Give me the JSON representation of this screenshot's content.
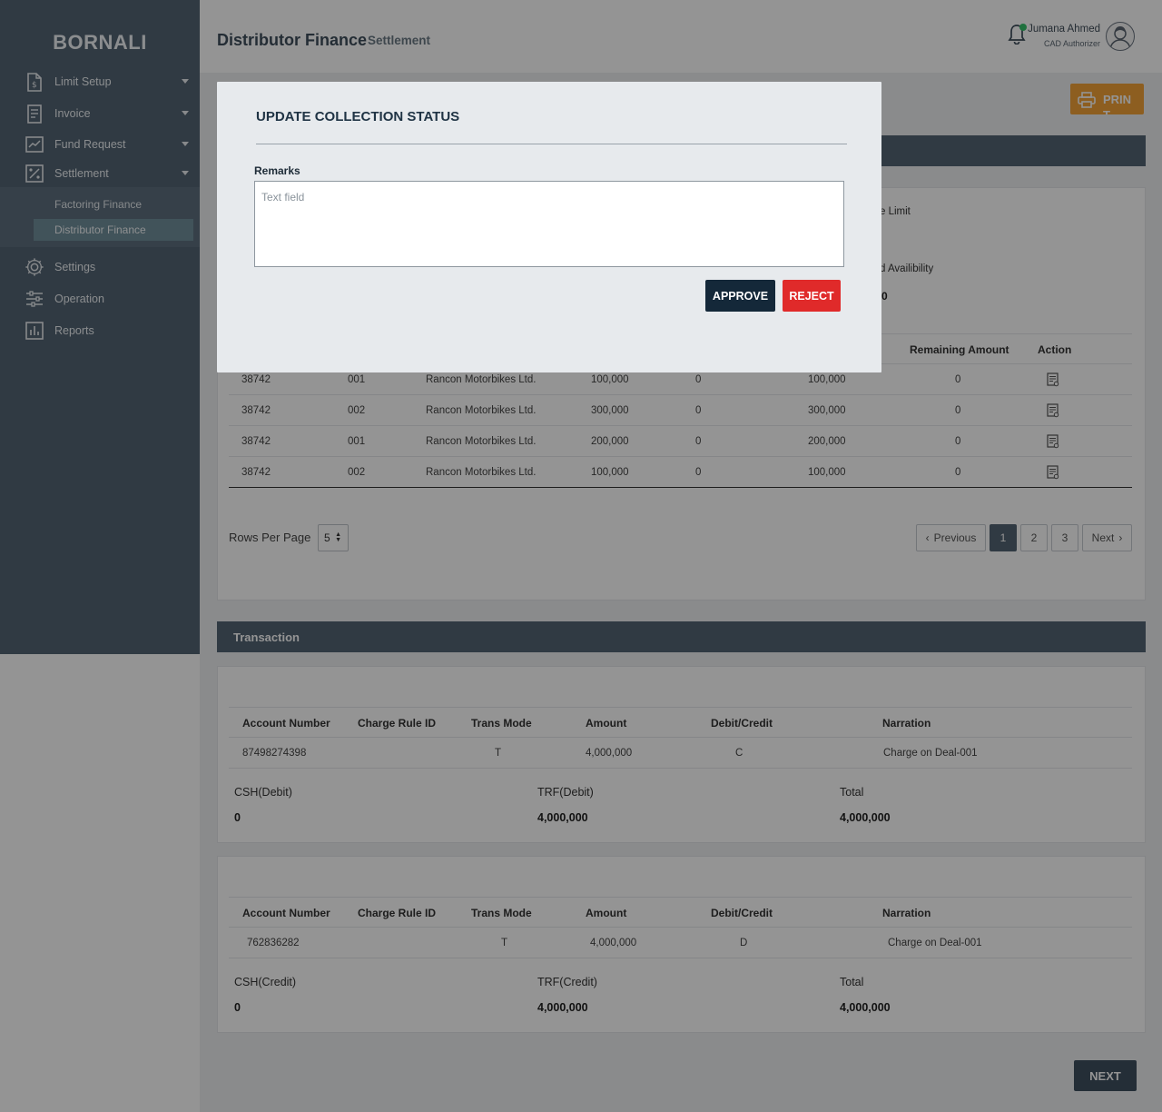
{
  "sidebar": {
    "brand": "BORNALI",
    "items": [
      {
        "label": "Limit Setup",
        "icon": "file-dollar-icon"
      },
      {
        "label": "Invoice",
        "icon": "receipt-icon"
      },
      {
        "label": "Fund Request",
        "icon": "chart-line-icon"
      },
      {
        "label": "Settlement",
        "icon": "percent-icon"
      },
      {
        "label": "Settings",
        "icon": "gear-icon"
      },
      {
        "label": "Operation",
        "icon": "sliders-icon"
      },
      {
        "label": "Reports",
        "icon": "bar-chart-icon"
      }
    ],
    "submenu": [
      {
        "label": "Factoring Finance"
      },
      {
        "label": "Distributor Finance",
        "active": true
      }
    ]
  },
  "header": {
    "title": "Distributor Finance",
    "subtitle": "Settlement",
    "user_name": "Jumana Ahmed",
    "user_role": "CAD Authorizer"
  },
  "toolbar": {
    "print_label": "PRINT"
  },
  "limit": {
    "label_1": "e Limit",
    "label_2": "d Availibility",
    "value_2": "0"
  },
  "invoice_table": {
    "headers": {
      "remaining": "Remaining Amount",
      "action": "Action"
    },
    "rows": [
      [
        "38742",
        "001",
        "Rancon Motorbikes Ltd.",
        "100,000",
        "0",
        "100,000",
        "0"
      ],
      [
        "38742",
        "002",
        "Rancon Motorbikes Ltd.",
        "300,000",
        "0",
        "300,000",
        "0"
      ],
      [
        "38742",
        "001",
        "Rancon Motorbikes Ltd.",
        "200,000",
        "0",
        "200,000",
        "0"
      ],
      [
        "38742",
        "002",
        "Rancon Motorbikes Ltd.",
        "100,000",
        "0",
        "100,000",
        "0"
      ]
    ]
  },
  "pagination": {
    "rows_label": "Rows Per Page",
    "rows_value": "5",
    "previous": "Previous",
    "pages": [
      "1",
      "2",
      "3"
    ],
    "next": "Next"
  },
  "transaction": {
    "title": "Transaction",
    "headers": [
      "Account Number",
      "Charge Rule ID",
      "Trans Mode",
      "Amount",
      "Debit/Credit",
      "Narration"
    ],
    "debit_card": {
      "row": [
        "87498274398",
        "",
        "T",
        "4,000,000",
        "C",
        "Charge on Deal-001"
      ],
      "summary": [
        {
          "label": "CSH(Debit)",
          "value": "0"
        },
        {
          "label": "TRF(Debit)",
          "value": "4,000,000"
        },
        {
          "label": "Total",
          "value": "4,000,000"
        }
      ]
    },
    "credit_card": {
      "row": [
        "762836282",
        "",
        "T",
        "4,000,000",
        "D",
        "Charge on Deal-001"
      ],
      "summary": [
        {
          "label": "CSH(Credit)",
          "value": "0"
        },
        {
          "label": "TRF(Credit)",
          "value": "4,000,000"
        },
        {
          "label": "Total",
          "value": "4,000,000"
        }
      ]
    }
  },
  "footer": {
    "next_label": "NEXT"
  },
  "modal": {
    "title": "UPDATE COLLECTION STATUS",
    "remarks_label": "Remarks",
    "remarks_placeholder": "Text field",
    "approve_label": "APPROVE",
    "reject_label": "REJECT"
  }
}
